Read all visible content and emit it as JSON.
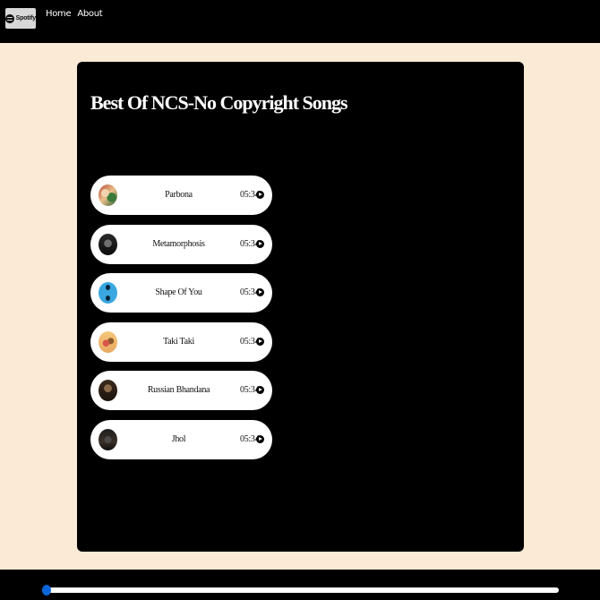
{
  "navbar": {
    "brand_name": "Spotify",
    "links": [
      {
        "label": "Home"
      },
      {
        "label": "About"
      }
    ]
  },
  "playlist": {
    "title": "Best Of NCS-No Copyright Songs",
    "songs": [
      {
        "name": "Parbona",
        "duration": "05:34"
      },
      {
        "name": "Metamorphosis",
        "duration": "05:34"
      },
      {
        "name": "Shape Of You",
        "duration": "05:34"
      },
      {
        "name": "Taki Taki",
        "duration": "05:34"
      },
      {
        "name": "Russian Bhandana",
        "duration": "05:34"
      },
      {
        "name": "Jhol",
        "duration": "05:34"
      }
    ]
  },
  "player": {
    "progress_percent": 0,
    "accent_color": "#0a66d8"
  },
  "colors": {
    "page_background": "#fbead6",
    "panel_background": "#000000"
  }
}
